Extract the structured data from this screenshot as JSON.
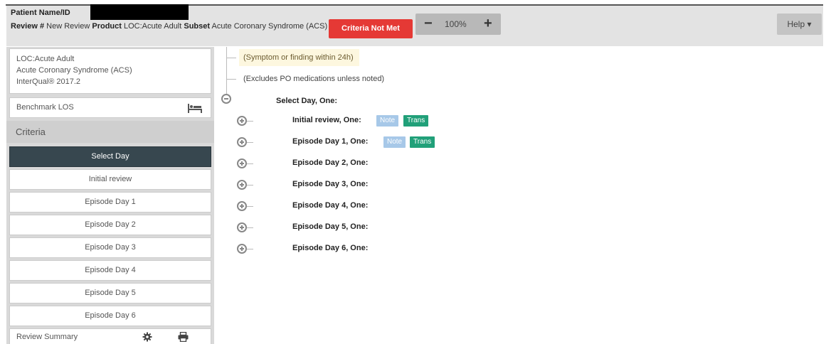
{
  "header": {
    "patient_label": "Patient Name/ID",
    "review_label": "Review #",
    "review_value": "New Review",
    "product_label": "Product",
    "product_value": "LOC:Acute Adult",
    "subset_label": "Subset",
    "subset_value": "Acute Coronary Syndrome (ACS)",
    "criteria_status": "Criteria Not Met",
    "zoom_level": "100%",
    "help_label": "Help ▾"
  },
  "sidebar": {
    "product": "LOC:Acute Adult",
    "subset": "Acute Coronary Syndrome (ACS)",
    "version": "InterQual® 2017.2",
    "benchmark_label": "Benchmark LOS",
    "criteria_label": "Criteria",
    "days": [
      {
        "label": "Select Day",
        "active": true
      },
      {
        "label": "Initial review",
        "active": false
      },
      {
        "label": "Episode Day 1",
        "active": false
      },
      {
        "label": "Episode Day 2",
        "active": false
      },
      {
        "label": "Episode Day 3",
        "active": false
      },
      {
        "label": "Episode Day 4",
        "active": false
      },
      {
        "label": "Episode Day 5",
        "active": false
      },
      {
        "label": "Episode Day 6",
        "active": false
      }
    ],
    "summary_label": "Review Summary"
  },
  "tree": {
    "note_symptom": "(Symptom or finding within 24h)",
    "note_excludes": "(Excludes PO medications unless noted)",
    "select_label": "Select Day, One:",
    "items": [
      {
        "label": "Initial review, One:",
        "note": "Note",
        "trans": "Trans"
      },
      {
        "label": "Episode Day 1, One:",
        "note": "Note",
        "trans": "Trans"
      },
      {
        "label": "Episode Day 2, One:"
      },
      {
        "label": "Episode Day 3, One:"
      },
      {
        "label": "Episode Day 4, One:"
      },
      {
        "label": "Episode Day 5, One:"
      },
      {
        "label": "Episode Day 6, One:"
      }
    ]
  },
  "colors": {
    "criteria_not_met": "#e53935",
    "active_day": "#37474f",
    "note_tag": "#a7c8e8",
    "trans_tag": "#21a079"
  }
}
